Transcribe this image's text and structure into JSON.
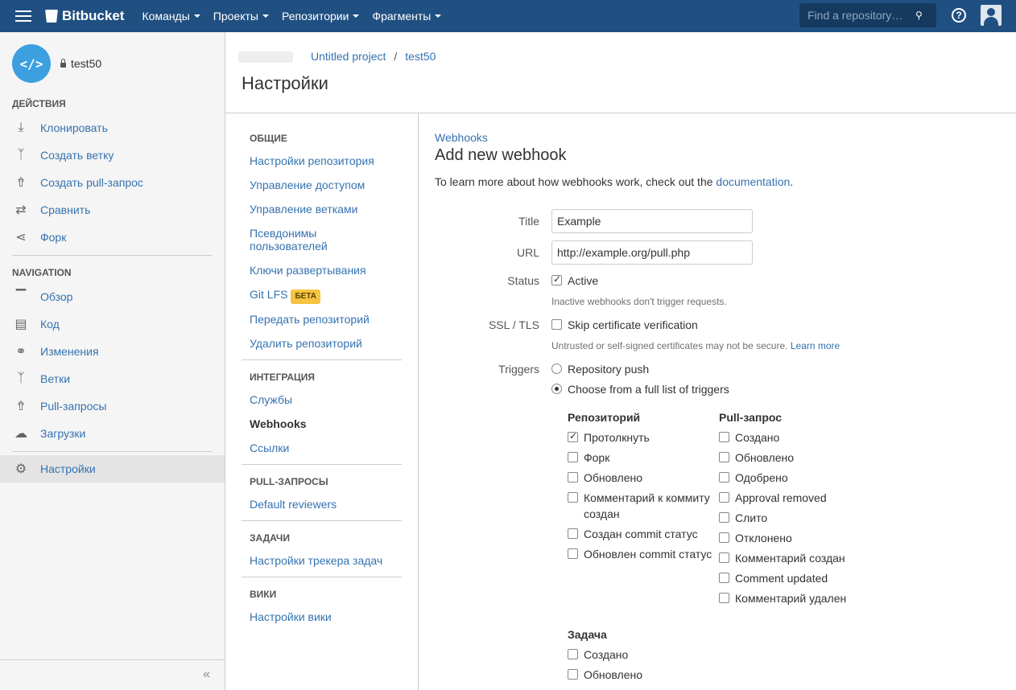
{
  "topbar": {
    "logo": "Bitbucket",
    "nav": [
      "Команды",
      "Проекты",
      "Репозитории",
      "Фрагменты"
    ],
    "search_placeholder": "Find a repository…",
    "help": "?"
  },
  "sidebar": {
    "repo_name": "test50",
    "repo_avatar": "</>",
    "actions_heading": "ДЕЙСТВИЯ",
    "actions": [
      {
        "label": "Клонировать",
        "icon": "download-icon"
      },
      {
        "label": "Создать ветку",
        "icon": "branch-icon"
      },
      {
        "label": "Создать pull-запрос",
        "icon": "pull-request-create-icon"
      },
      {
        "label": "Сравнить",
        "icon": "compare-icon"
      },
      {
        "label": "Форк",
        "icon": "fork-icon"
      }
    ],
    "navigation_heading": "NAVIGATION",
    "navigation": [
      {
        "label": "Обзор",
        "icon": "overview-icon"
      },
      {
        "label": "Код",
        "icon": "source-icon"
      },
      {
        "label": "Изменения",
        "icon": "commits-icon"
      },
      {
        "label": "Ветки",
        "icon": "branches-icon"
      },
      {
        "label": "Pull-запросы",
        "icon": "pull-requests-icon"
      },
      {
        "label": "Загрузки",
        "icon": "downloads-icon"
      }
    ],
    "settings": {
      "label": "Настройки",
      "icon": "gear-icon"
    },
    "collapse": "«"
  },
  "header": {
    "breadcrumb": [
      "Untitled project",
      "test50"
    ],
    "separator": "/",
    "title": "Настройки"
  },
  "settings_nav": {
    "groups": [
      {
        "heading": "ОБЩИЕ",
        "items": [
          "Настройки репозитория",
          "Управление доступом",
          "Управление ветками",
          "Псевдонимы пользователей",
          "Ключи развертывания",
          "Git LFS",
          "Передать репозиторий",
          "Удалить репозиторий"
        ]
      },
      {
        "heading": "ИНТЕГРАЦИЯ",
        "items": [
          "Службы",
          "Webhooks",
          "Ссылки"
        ]
      },
      {
        "heading": "PULL-ЗАПРОСЫ",
        "items": [
          "Default reviewers"
        ]
      },
      {
        "heading": "ЗАДАЧИ",
        "items": [
          "Настройки трекера задач"
        ]
      },
      {
        "heading": "ВИКИ",
        "items": [
          "Настройки вики"
        ]
      }
    ],
    "beta_badge": "БЕТА",
    "active": "Webhooks"
  },
  "content": {
    "crumb": "Webhooks",
    "title": "Add new webhook",
    "intro": "To learn more about how webhooks work, check out the",
    "intro_link": "documentation",
    "intro_end": ".",
    "form": {
      "title_label": "Title",
      "title_value": "Example",
      "url_label": "URL",
      "url_value": "http://example.org/pull.php",
      "status_label": "Status",
      "status_option": "Active",
      "status_checked": true,
      "status_hint": "Inactive webhooks don't trigger requests.",
      "ssl_label": "SSL / TLS",
      "ssl_option": "Skip certificate verification",
      "ssl_checked": false,
      "ssl_hint": "Untrusted or self-signed certificates may not be secure.",
      "ssl_hint_link": "Learn more",
      "triggers_label": "Triggers",
      "trigger_options": [
        "Repository push",
        "Choose from a full list of triggers"
      ],
      "trigger_selected": 1
    },
    "trigger_groups": {
      "repository": {
        "title": "Репозиторий",
        "items": [
          {
            "label": "Протолкнуть",
            "checked": true
          },
          {
            "label": "Форк",
            "checked": false
          },
          {
            "label": "Обновлено",
            "checked": false
          },
          {
            "label": "Комментарий к коммиту создан",
            "checked": false
          },
          {
            "label": "Создан commit статус",
            "checked": false
          },
          {
            "label": "Обновлен commit статус",
            "checked": false
          }
        ]
      },
      "pull_request": {
        "title": "Pull-запрос",
        "items": [
          {
            "label": "Создано",
            "checked": false
          },
          {
            "label": "Обновлено",
            "checked": false
          },
          {
            "label": "Одобрено",
            "checked": false
          },
          {
            "label": "Approval removed",
            "checked": false
          },
          {
            "label": "Слито",
            "checked": false
          },
          {
            "label": "Отклонено",
            "checked": false
          },
          {
            "label": "Комментарий создан",
            "checked": false
          },
          {
            "label": "Comment updated",
            "checked": false
          },
          {
            "label": "Комментарий удален",
            "checked": false
          }
        ]
      },
      "issue": {
        "title": "Задача",
        "items": [
          {
            "label": "Создано",
            "checked": false
          },
          {
            "label": "Обновлено",
            "checked": false
          }
        ]
      }
    }
  }
}
